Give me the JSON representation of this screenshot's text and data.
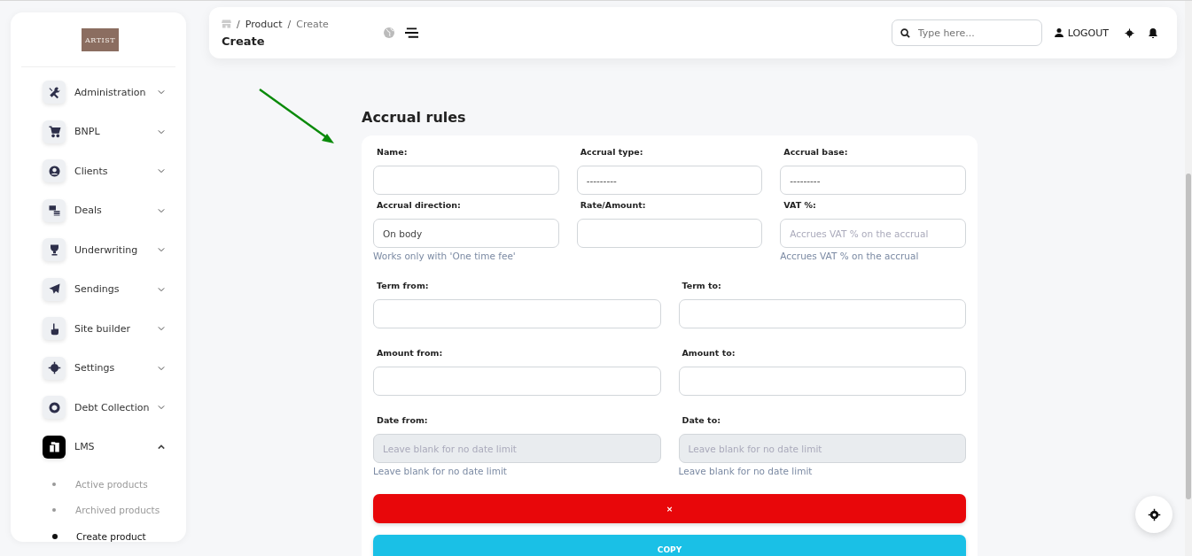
{
  "logo": {
    "text": "ARTIST"
  },
  "sidebar": {
    "items": [
      {
        "label": "Administration",
        "expanded": false,
        "active": false
      },
      {
        "label": "BNPL",
        "expanded": false,
        "active": false
      },
      {
        "label": "Clients",
        "expanded": false,
        "active": false
      },
      {
        "label": "Deals",
        "expanded": false,
        "active": false
      },
      {
        "label": "Underwriting",
        "expanded": false,
        "active": false
      },
      {
        "label": "Sendings",
        "expanded": false,
        "active": false
      },
      {
        "label": "Site builder",
        "expanded": false,
        "active": false
      },
      {
        "label": "Settings",
        "expanded": false,
        "active": false
      },
      {
        "label": "Debt Collection",
        "expanded": false,
        "active": false
      },
      {
        "label": "LMS",
        "expanded": true,
        "active": true,
        "children": [
          {
            "label": "Active products",
            "selected": false
          },
          {
            "label": "Archived products",
            "selected": false
          },
          {
            "label": "Create product",
            "selected": true
          }
        ]
      }
    ]
  },
  "header": {
    "breadcrumb": [
      {
        "separator": "/",
        "label": "Product"
      },
      {
        "separator": "/",
        "label": "Create"
      }
    ],
    "title": "Create",
    "search": {
      "placeholder": "Type here..."
    },
    "logout": "LOGOUT"
  },
  "form": {
    "title": "Accrual rules",
    "rows": [
      {
        "fields": [
          {
            "label": "Name:",
            "disabled": false
          },
          {
            "label": "Accrual type:",
            "value": "---------",
            "disabled": false
          },
          {
            "label": "Accrual base:",
            "value": "---------",
            "disabled": false
          }
        ]
      },
      {
        "fields": [
          {
            "label": "Accrual direction:",
            "value": "On body",
            "hint": "Works only with 'One time fee'",
            "disabled": false
          },
          {
            "label": "Rate/Amount:",
            "disabled": false
          },
          {
            "label": "VAT %:",
            "placeholder": "Accrues VAT % on the accrual",
            "hint": "Accrues VAT % on the accrual",
            "disabled": false
          }
        ]
      },
      {
        "fields": [
          {
            "label": "Term from:",
            "disabled": false
          },
          {
            "label": "Term to:",
            "disabled": false
          }
        ]
      },
      {
        "fields": [
          {
            "label": "Amount from:",
            "disabled": false
          },
          {
            "label": "Amount to:",
            "disabled": false
          }
        ]
      },
      {
        "fields": [
          {
            "label": "Date from:",
            "placeholder": "Leave blank for no date limit",
            "hint": "Leave blank for no date limit",
            "disabled": true
          },
          {
            "label": "Date to:",
            "placeholder": "Leave blank for no date limit",
            "hint": "Leave blank for no date limit",
            "disabled": true
          }
        ]
      }
    ],
    "buttons": [
      {
        "kind": "delete",
        "label": "×"
      },
      {
        "kind": "copy",
        "label": "COPY"
      }
    ]
  }
}
